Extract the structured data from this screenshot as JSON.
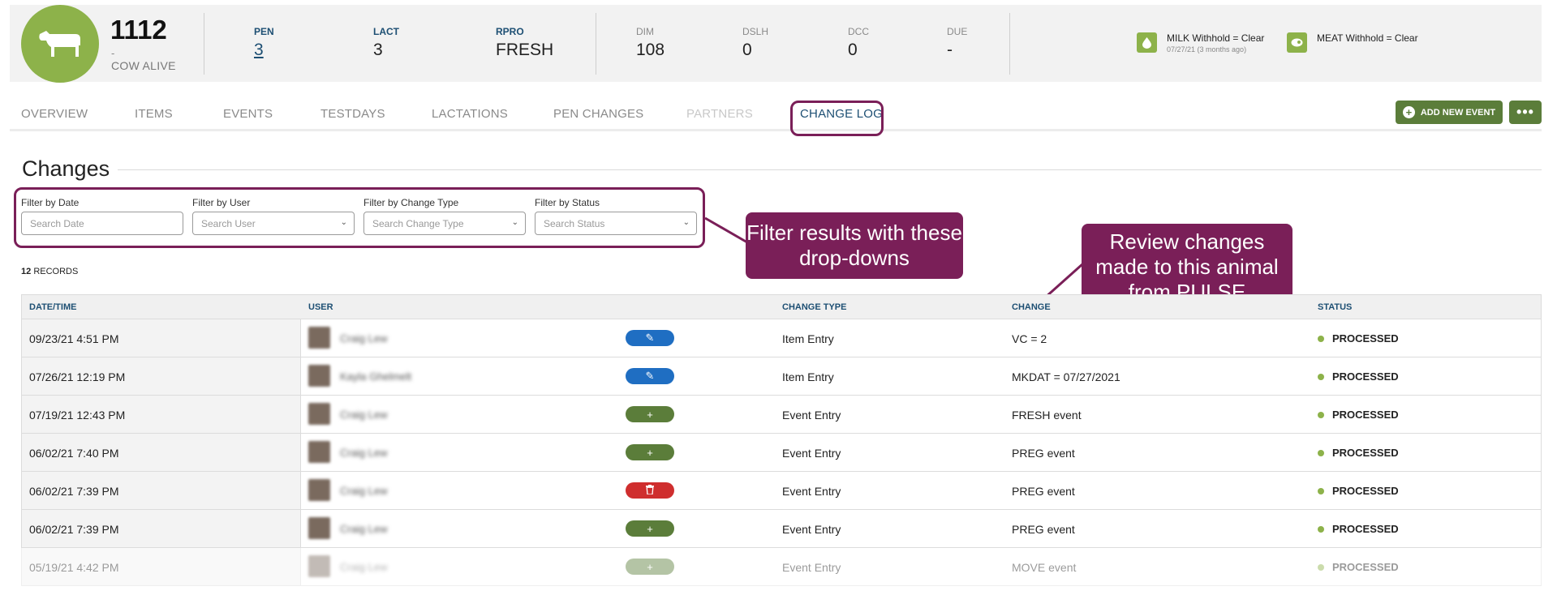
{
  "animal": {
    "id": "1112",
    "dash": "-",
    "status": "COW ALIVE",
    "stats": [
      {
        "label": "PEN",
        "value": "3"
      },
      {
        "label": "LACT",
        "value": "3"
      },
      {
        "label": "RPRO",
        "value": "FRESH"
      },
      {
        "label": "DIM",
        "value": "108"
      },
      {
        "label": "DSLH",
        "value": "0"
      },
      {
        "label": "DCC",
        "value": "0"
      },
      {
        "label": "DUE",
        "value": "-"
      }
    ],
    "withhold": {
      "milk_label": "MILK Withhold = Clear",
      "milk_sub": "07/27/21 (3 months ago)",
      "meat_label": "MEAT Withhold = Clear"
    }
  },
  "tabs": [
    "OVERVIEW",
    "ITEMS",
    "EVENTS",
    "TESTDAYS",
    "LACTATIONS",
    "PEN CHANGES",
    "PARTNERS",
    "CHANGE LOG"
  ],
  "active_tab": "CHANGE LOG",
  "actions": {
    "add_event": "ADD NEW EVENT",
    "more": "•••"
  },
  "section_title": "Changes",
  "filters": [
    {
      "label": "Filter by Date",
      "placeholder": "Search Date"
    },
    {
      "label": "Filter by User",
      "placeholder": "Search User"
    },
    {
      "label": "Filter by Change Type",
      "placeholder": "Search Change Type"
    },
    {
      "label": "Filter by Status",
      "placeholder": "Search Status"
    }
  ],
  "callouts": {
    "filters": "Filter results with these drop-downs",
    "changes": "Review changes made to this animal from PULSE"
  },
  "records": {
    "count": "12",
    "label": "RECORDS"
  },
  "table": {
    "headers": {
      "datetime": "DATE/TIME",
      "user": "USER",
      "change_type": "CHANGE TYPE",
      "change": "CHANGE",
      "status": "STATUS"
    },
    "rows": [
      {
        "date": "09/23/21 4:51 PM",
        "user": "Craig Lew",
        "action": "edit",
        "type": "Item Entry",
        "change": "VC = 2",
        "status": "PROCESSED"
      },
      {
        "date": "07/26/21 12:19 PM",
        "user": "Kayla Ghelmelt",
        "action": "edit",
        "type": "Item Entry",
        "change": "MKDAT = 07/27/2021",
        "status": "PROCESSED"
      },
      {
        "date": "07/19/21 12:43 PM",
        "user": "Craig Lew",
        "action": "add",
        "type": "Event Entry",
        "change": "FRESH event",
        "status": "PROCESSED"
      },
      {
        "date": "06/02/21 7:40 PM",
        "user": "Craig Lew",
        "action": "add",
        "type": "Event Entry",
        "change": "PREG event",
        "status": "PROCESSED"
      },
      {
        "date": "06/02/21 7:39 PM",
        "user": "Craig Lew",
        "action": "delete",
        "type": "Event Entry",
        "change": "PREG event",
        "status": "PROCESSED"
      },
      {
        "date": "06/02/21 7:39 PM",
        "user": "Craig Lew",
        "action": "add",
        "type": "Event Entry",
        "change": "PREG event",
        "status": "PROCESSED"
      },
      {
        "date": "05/19/21 4:42 PM",
        "user": "Craig Lew",
        "action": "add",
        "type": "Event Entry",
        "change": "MOVE event",
        "status": "PROCESSED"
      }
    ]
  },
  "colors": {
    "brand_green": "#8db24a",
    "action_green": "#5b7d3a",
    "highlight": "#7a1f58",
    "nav_blue": "#1d4f73",
    "edit_blue": "#1f6ec2",
    "delete_red": "#cf2e2e"
  }
}
